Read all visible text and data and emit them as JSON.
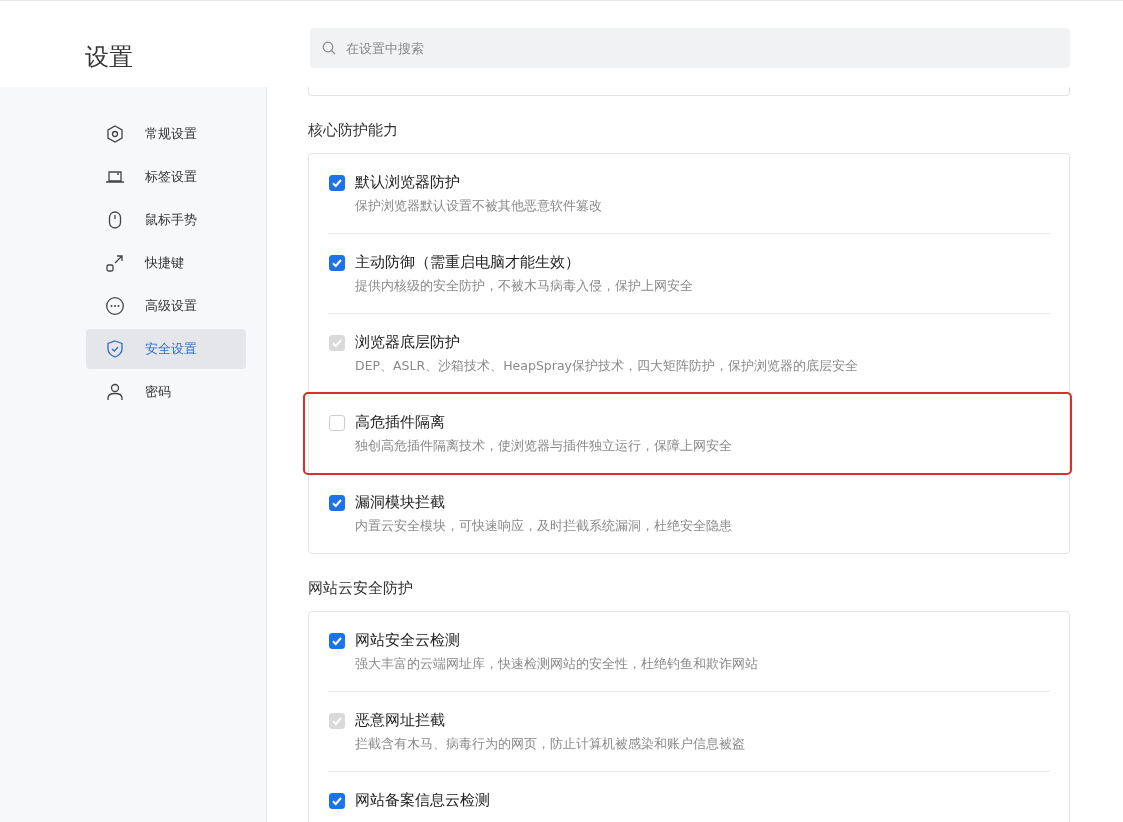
{
  "header": {
    "title": "设置",
    "search": {
      "placeholder": "在设置中搜索"
    }
  },
  "sidebar": {
    "items": [
      {
        "label": "常规设置",
        "selected": false
      },
      {
        "label": "标签设置",
        "selected": false
      },
      {
        "label": "鼠标手势",
        "selected": false
      },
      {
        "label": "快捷键",
        "selected": false
      },
      {
        "label": "高级设置",
        "selected": false
      },
      {
        "label": "安全设置",
        "selected": true
      },
      {
        "label": "密码",
        "selected": false
      }
    ]
  },
  "sections": [
    {
      "title": "核心防护能力",
      "items": [
        {
          "label": "默认浏览器防护",
          "description": "保护浏览器默认设置不被其他恶意软件篡改",
          "checked": true,
          "disabled": false,
          "highlighted": false
        },
        {
          "label": "主动防御（需重启电脑才能生效）",
          "description": "提供内核级的安全防护，不被木马病毒入侵，保护上网安全",
          "checked": true,
          "disabled": false,
          "highlighted": false
        },
        {
          "label": "浏览器底层防护",
          "description": "DEP、ASLR、沙箱技术、HeapSpray保护技术，四大矩阵防护，保护浏览器的底层安全",
          "checked": true,
          "disabled": true,
          "highlighted": false
        },
        {
          "label": "高危插件隔离",
          "description": "独创高危插件隔离技术，使浏览器与插件独立运行，保障上网安全",
          "checked": false,
          "disabled": false,
          "highlighted": true
        },
        {
          "label": "漏洞模块拦截",
          "description": "内置云安全模块，可快速响应，及时拦截系统漏洞，杜绝安全隐患",
          "checked": true,
          "disabled": false,
          "highlighted": false
        }
      ]
    },
    {
      "title": "网站云安全防护",
      "items": [
        {
          "label": "网站安全云检测",
          "description": "强大丰富的云端网址库，快速检测网站的安全性，杜绝钓鱼和欺诈网站",
          "checked": true,
          "disabled": false,
          "highlighted": false
        },
        {
          "label": "恶意网址拦截",
          "description": "拦截含有木马、病毒行为的网页，防止计算机被感染和账户信息被盗",
          "checked": true,
          "disabled": true,
          "highlighted": false
        },
        {
          "label": "网站备案信息云检测",
          "checked": true,
          "disabled": false,
          "highlighted": false
        }
      ]
    }
  ]
}
